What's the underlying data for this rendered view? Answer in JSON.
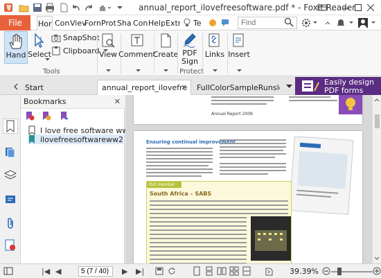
{
  "window": {
    "title": "annual_report_ilovefreesoftware.pdf * - Foxit Reader"
  },
  "ribbon_tabs": [
    "Hor",
    "Con",
    "Viev",
    "Forn",
    "Prot",
    "Sha",
    "Con",
    "Help",
    "Extr"
  ],
  "tell_me": "Te",
  "file_tab": "File",
  "search": {
    "placeholder": "Find"
  },
  "ribbon": {
    "hand": "Hand",
    "select": "Select",
    "snapshot": "SnapShot",
    "clipboard": "Clipboard",
    "view": "View",
    "comment": "Comment",
    "create": "Create",
    "pdf_sign_1": "PDF",
    "pdf_sign_2": "Sign",
    "links": "Links",
    "insert": "Insert",
    "group_tools": "Tools",
    "group_protect": "Protect"
  },
  "doc_tabs": {
    "start": "Start",
    "active": "annual_report_ilovefre",
    "other": "FullColorSampleRunslo"
  },
  "ad": {
    "line1": "Easily design",
    "line2": "PDF forms"
  },
  "bookmarks": {
    "title": "Bookmarks",
    "items": [
      "I love free software ww1",
      "ilovefreesoftwareww2"
    ]
  },
  "document": {
    "heading_left": "Ensuring continual improvement",
    "section_label": "ISO member",
    "section_title": "South Africa – SABS",
    "footer_left": "Annual Report 2009"
  },
  "status": {
    "page_field": "5 (7 / 40)",
    "zoom": "39.39%"
  },
  "zoom_level": 0.3939,
  "colors": {
    "file_tab": "#e8613a",
    "ad_background": "#5a2d82",
    "accent_blue": "#2b6cb5"
  }
}
